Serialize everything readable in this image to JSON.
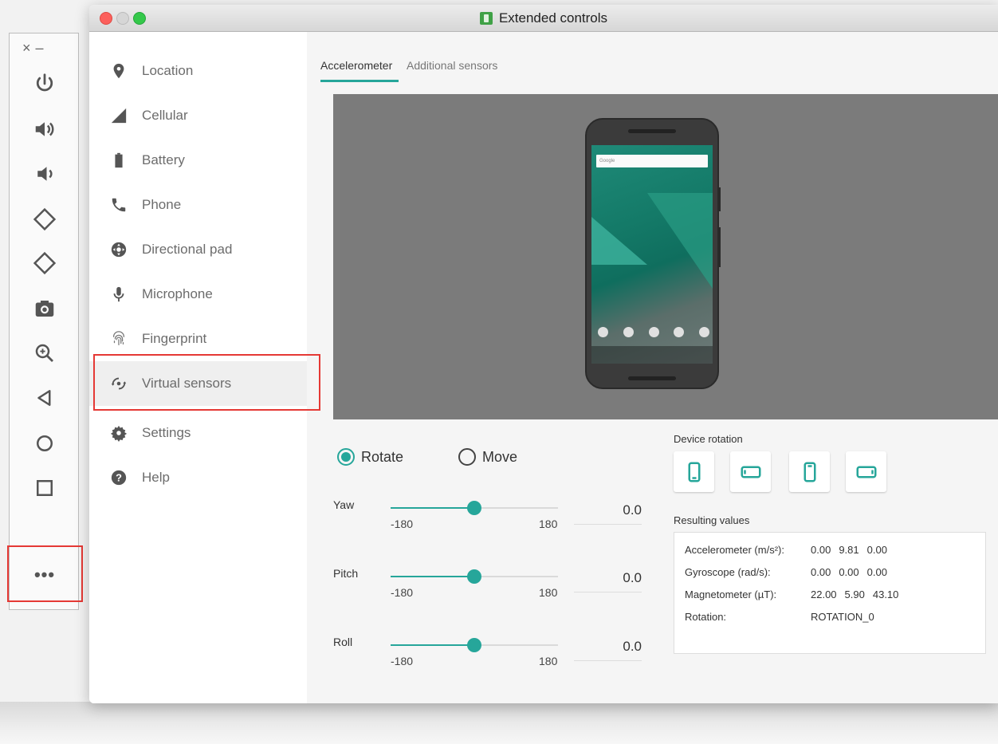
{
  "window": {
    "title": "Extended controls"
  },
  "toolbar": {
    "top_close": "×",
    "top_min": "–",
    "buttons": [
      "power-icon",
      "volume-up-icon",
      "volume-down-icon",
      "rotate-left-icon",
      "rotate-right-icon",
      "camera-icon",
      "zoom-icon",
      "back-icon",
      "home-icon",
      "overview-icon"
    ],
    "more_label": "•••"
  },
  "nav": {
    "items": [
      {
        "label": "Location",
        "icon": "location-pin-icon"
      },
      {
        "label": "Cellular",
        "icon": "signal-icon"
      },
      {
        "label": "Battery",
        "icon": "battery-icon"
      },
      {
        "label": "Phone",
        "icon": "phone-icon"
      },
      {
        "label": "Directional pad",
        "icon": "dpad-icon"
      },
      {
        "label": "Microphone",
        "icon": "microphone-icon"
      },
      {
        "label": "Fingerprint",
        "icon": "fingerprint-icon"
      },
      {
        "label": "Virtual sensors",
        "icon": "virtual-sensors-icon",
        "selected": true
      },
      {
        "label": "Settings",
        "icon": "gear-icon"
      },
      {
        "label": "Help",
        "icon": "help-icon"
      }
    ]
  },
  "tabs": [
    {
      "label": "Accelerometer",
      "active": true
    },
    {
      "label": "Additional sensors",
      "active": false
    }
  ],
  "phone": {
    "search_text": "Google"
  },
  "mode": {
    "rotate_label": "Rotate",
    "move_label": "Move",
    "selected": "Rotate"
  },
  "sliders": [
    {
      "label": "Yaw",
      "min": "-180",
      "max": "180",
      "value": "0.0",
      "fraction": 0.5
    },
    {
      "label": "Pitch",
      "min": "-180",
      "max": "180",
      "value": "0.0",
      "fraction": 0.5
    },
    {
      "label": "Roll",
      "min": "-180",
      "max": "180",
      "value": "0.0",
      "fraction": 0.5
    }
  ],
  "device_rotation": {
    "title": "Device rotation",
    "buttons": [
      "portrait-icon",
      "landscape-icon",
      "reverse-portrait-icon",
      "reverse-landscape-icon"
    ]
  },
  "resulting_values": {
    "title": "Resulting values",
    "rows": [
      {
        "key": "Accelerometer (m/s²):",
        "values": [
          "0.00",
          "9.81",
          "0.00"
        ]
      },
      {
        "key": "Gyroscope (rad/s):",
        "values": [
          "0.00",
          "0.00",
          "0.00"
        ]
      },
      {
        "key": "Magnetometer (µT):",
        "values": [
          "22.00",
          "5.90",
          "43.10"
        ]
      },
      {
        "key": "Rotation:",
        "values": [
          "ROTATION_0"
        ]
      }
    ]
  },
  "colors": {
    "accent": "#26a69a",
    "highlight": "#e53935",
    "viewport": "#7b7b7b"
  }
}
